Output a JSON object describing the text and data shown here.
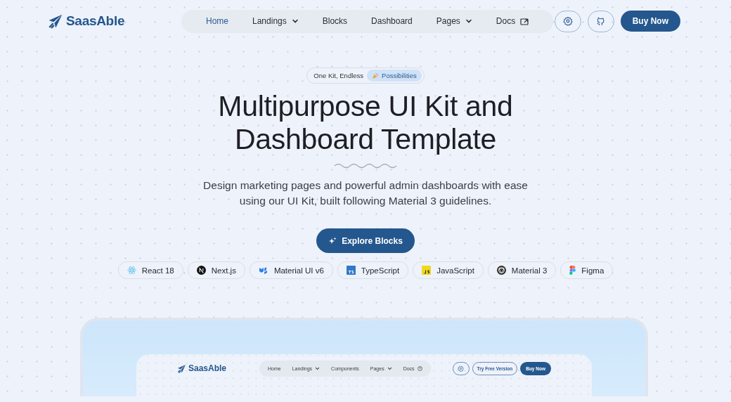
{
  "header": {
    "logo": "SaasAble",
    "nav": [
      {
        "label": "Home",
        "selected": true,
        "kind": "link"
      },
      {
        "label": "Landings",
        "selected": false,
        "kind": "dropdown"
      },
      {
        "label": "Blocks",
        "selected": false,
        "kind": "link"
      },
      {
        "label": "Dashboard",
        "selected": false,
        "kind": "link"
      },
      {
        "label": "Pages",
        "selected": false,
        "kind": "dropdown"
      },
      {
        "label": "Docs",
        "selected": false,
        "kind": "external"
      }
    ],
    "cta": "Buy Now"
  },
  "hero": {
    "badge": {
      "text": "One Kit, Endless",
      "highlight": "Possibilities"
    },
    "title_lines": [
      "Multipurpose UI Kit and",
      "Dashboard Template"
    ],
    "subtitle": "Design marketing pages and powerful admin dashboards with ease using our UI Kit, built following Material 3 guidelines.",
    "button": "Explore Blocks",
    "tech": [
      {
        "label": "React 18",
        "kind": "react"
      },
      {
        "label": "Next.js",
        "kind": "next"
      },
      {
        "label": "Material UI v6",
        "kind": "mui"
      },
      {
        "label": "TypeScript",
        "kind": "ts"
      },
      {
        "label": "JavaScript",
        "kind": "js"
      },
      {
        "label": "Material 3",
        "kind": "material"
      },
      {
        "label": "Figma",
        "kind": "figma"
      }
    ]
  },
  "preview": {
    "logo": "SaasAble",
    "nav": [
      {
        "label": "Home",
        "kind": "link"
      },
      {
        "label": "Landings",
        "kind": "dropdown"
      },
      {
        "label": "Components",
        "kind": "link"
      },
      {
        "label": "Pages",
        "kind": "dropdown"
      },
      {
        "label": "Docs",
        "kind": "help"
      }
    ],
    "secondary": "Try Free Version",
    "cta": "Buy Now"
  }
}
